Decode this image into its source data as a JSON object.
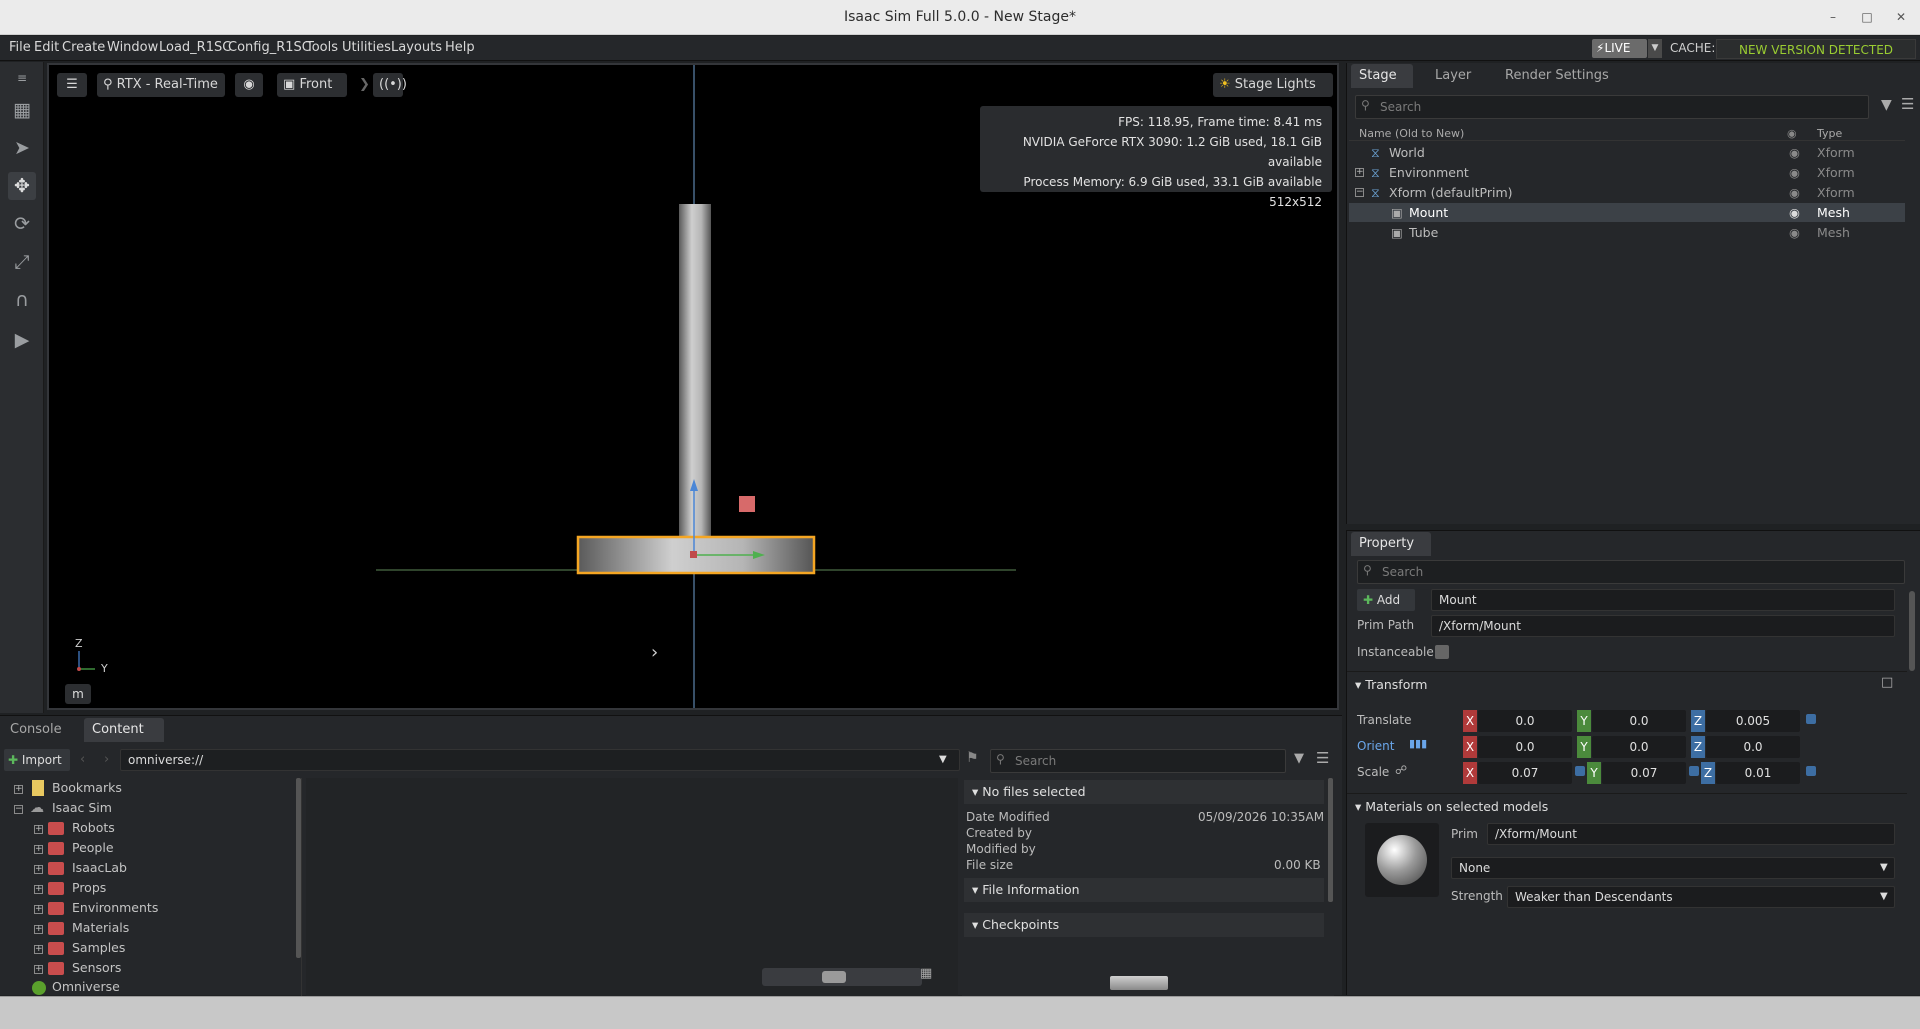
{
  "window": {
    "title": "Isaac Sim Full 5.0.0 - New Stage*"
  },
  "menu": [
    "File",
    "Edit",
    "Create",
    "Window",
    "Load_R1SC",
    "Config_R1SC",
    "Tools",
    "Utilities",
    "Layouts",
    "Help"
  ],
  "status": {
    "live": "LIVE",
    "cache_label": "CACHE:",
    "cache_status": "NEW VERSION DETECTED",
    "accent": "#9acd32"
  },
  "viewport": {
    "renderer": "RTX - Real-Time",
    "camera": "Front",
    "stage_lights": "Stage Lights",
    "stats": [
      "FPS: 118.95, Frame time: 8.41 ms",
      "NVIDIA GeForce RTX 3090: 1.2 GiB used, 18.1 GiB available",
      "Process Memory: 6.9 GiB used, 33.1 GiB available",
      "512x512"
    ],
    "axis_z": "Z",
    "axis_y": "Y",
    "units": "m",
    "selection_color": "#f5a623"
  },
  "stage": {
    "tabs": [
      "Stage",
      "Layer",
      "Render Settings"
    ],
    "search_placeholder": "Search",
    "col_name": "Name (Old to New)",
    "col_type": "Type",
    "rows": [
      {
        "name": "World",
        "type": "Xform"
      },
      {
        "name": "Environment",
        "type": "Xform"
      },
      {
        "name": "Xform (defaultPrim)",
        "type": "Xform"
      },
      {
        "name": "Mount",
        "type": "Mesh"
      },
      {
        "name": "Tube",
        "type": "Mesh"
      }
    ]
  },
  "property": {
    "tab": "Property",
    "search_placeholder": "Search",
    "add_label": "Add",
    "prim_name": "Mount",
    "prim_path_label": "Prim Path",
    "prim_path": "/Xform/Mount",
    "instanceable_label": "Instanceable",
    "transform_header": "Transform",
    "translate_label": "Translate",
    "orient_label": "Orient",
    "scale_label": "Scale",
    "translate": {
      "x": "0.0",
      "y": "0.0",
      "z": "0.005"
    },
    "orient": {
      "x": "0.0",
      "y": "0.0",
      "z": "0.0"
    },
    "scale": {
      "x": "0.07",
      "y": "0.07",
      "z": "0.01"
    },
    "axis_x": "X",
    "axis_y": "Y",
    "axis_z": "Z",
    "materials_header": "Materials on selected models",
    "mat_prim_label": "Prim",
    "mat_prim": "/Xform/Mount",
    "mat_value": "None",
    "strength_label": "Strength",
    "strength_value": "Weaker than Descendants"
  },
  "bottom": {
    "tabs": [
      "Console",
      "Content"
    ],
    "import_label": "Import",
    "path": "omniverse://",
    "search_placeholder": "Search",
    "tree": [
      "Bookmarks",
      "Isaac Sim",
      "Robots",
      "People",
      "IsaacLab",
      "Props",
      "Environments",
      "Materials",
      "Samples",
      "Sensors",
      "Omniverse"
    ],
    "details": {
      "no_files": "No files selected",
      "date_modified_label": "Date Modified",
      "date_modified": "05/09/2026 10:35AM",
      "created_by_label": "Created by",
      "modified_by_label": "Modified by",
      "file_size_label": "File size",
      "file_size": "0.00 KB",
      "file_info": "File Information",
      "checkpoints": "Checkpoints"
    }
  }
}
